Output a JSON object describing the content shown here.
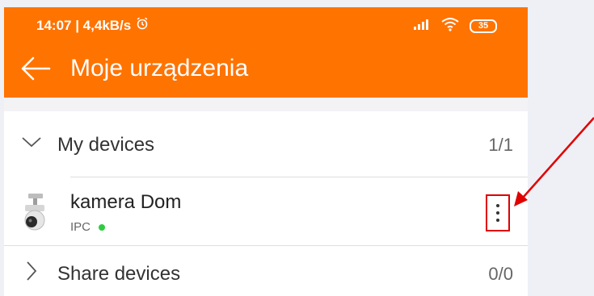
{
  "status_bar": {
    "time_speed": "14:07 | 4,4kB/s",
    "alarm_icon": "alarm-clock-icon",
    "battery_level": "35"
  },
  "header": {
    "back_icon": "arrow-left-icon",
    "title": "Moje urządzenia"
  },
  "groups": {
    "my_devices": {
      "label": "My devices",
      "count": "1/1",
      "expanded": true
    },
    "share_devices": {
      "label": "Share devices",
      "count": "0/0",
      "expanded": false
    }
  },
  "device": {
    "name": "kamera Dom",
    "type": "IPC",
    "online": true,
    "icon": "security-camera-icon",
    "more_icon": "more-vertical-icon"
  },
  "colors": {
    "accent": "#ff7300",
    "online": "#2ecc40",
    "highlight": "#e00000"
  }
}
